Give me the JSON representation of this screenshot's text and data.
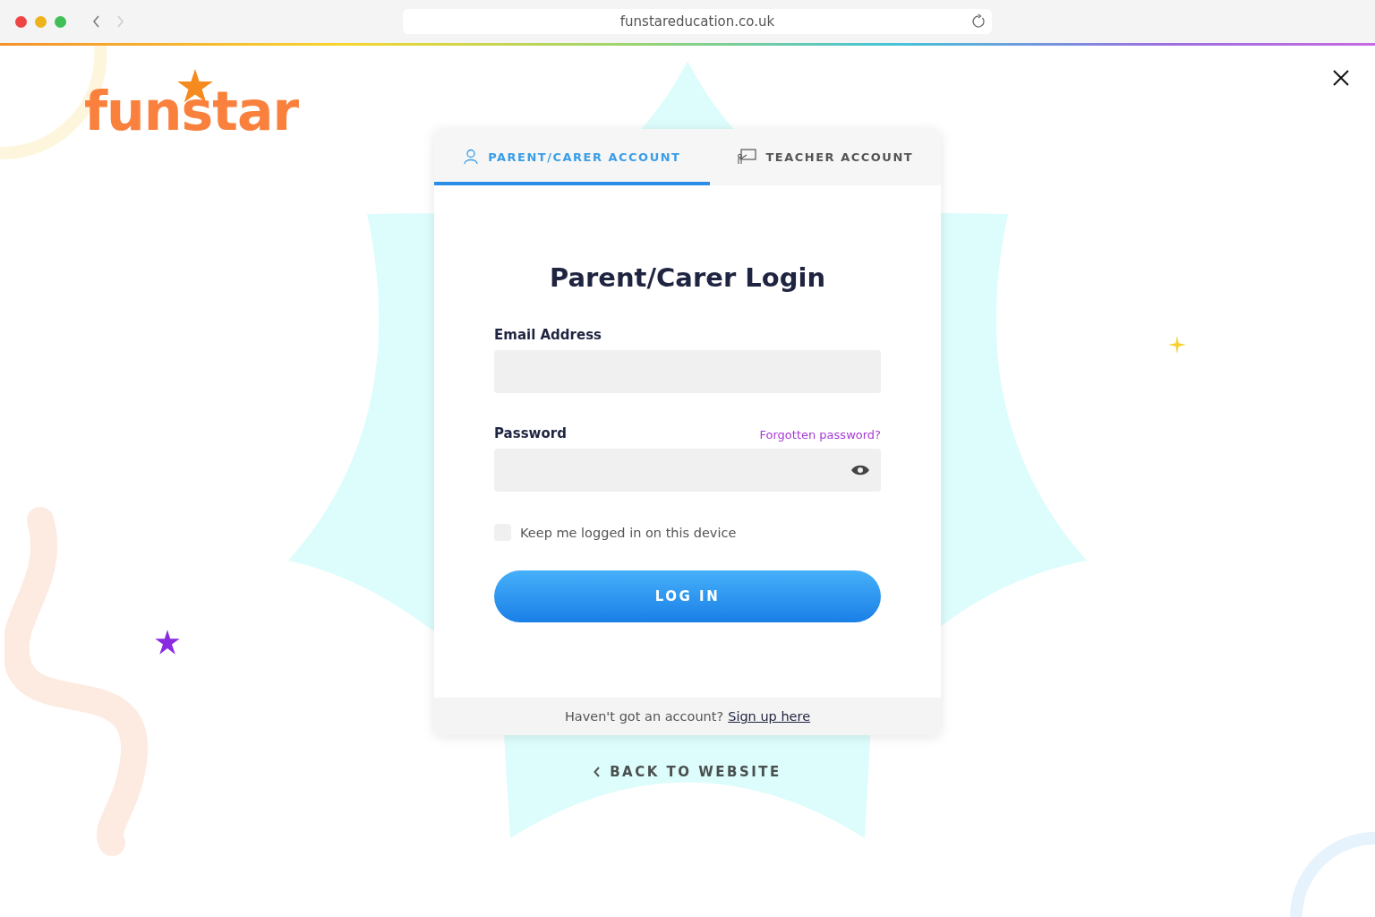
{
  "browser": {
    "url": "funstareducation.co.uk"
  },
  "logo": {
    "text": "funstar"
  },
  "tabs": [
    {
      "label": "PARENT/CARER ACCOUNT",
      "kind": "parent",
      "selected": true
    },
    {
      "label": "TEACHER ACCOUNT",
      "kind": "teacher",
      "selected": false
    }
  ],
  "form": {
    "title": "Parent/Carer Login",
    "email_label": "Email Address",
    "password_label": "Password",
    "forgot_link": "Forgotten password?",
    "remember": {
      "label": "Keep me logged in on this device",
      "checked": false
    },
    "submit": "LOG IN"
  },
  "footer": {
    "text": "Haven't got an account?",
    "link": "Sign up here"
  },
  "back_link": "BACK TO WEBSITE"
}
